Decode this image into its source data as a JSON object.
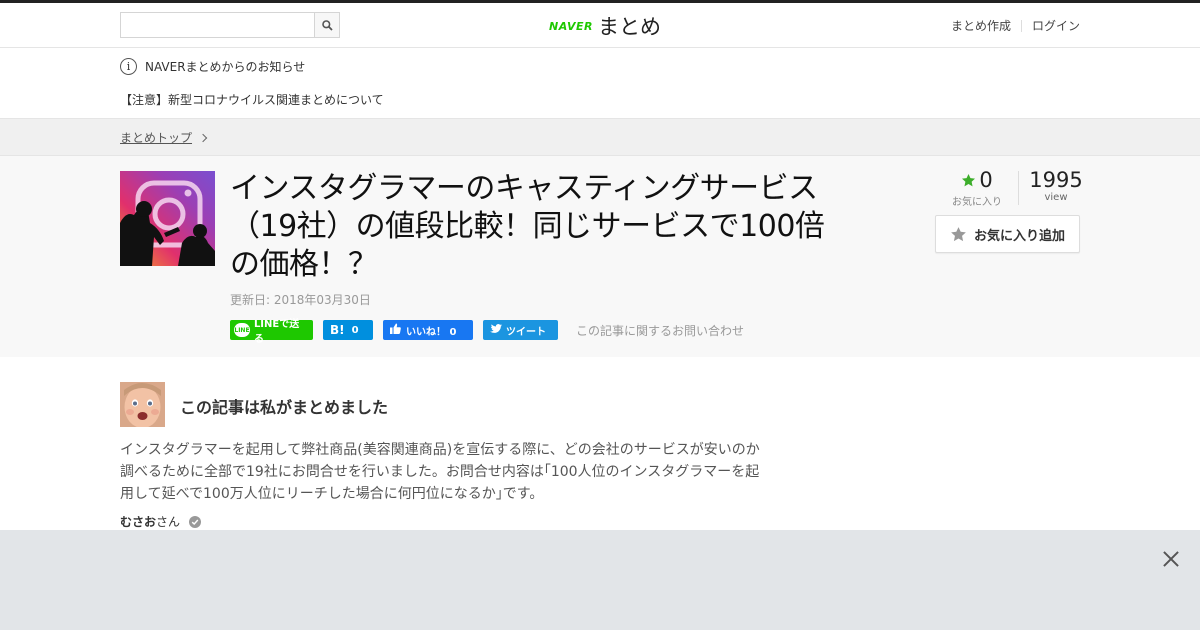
{
  "header": {
    "search": {
      "value": "",
      "placeholder": ""
    },
    "logo": {
      "brand": "NAVER",
      "name": "まとめ"
    },
    "links": {
      "create": "まとめ作成",
      "login": "ログイン"
    }
  },
  "notice": {
    "heading": "NAVERまとめからのお知らせ",
    "item": "【注意】新型コロナウイルス関連まとめについて"
  },
  "breadcrumb": {
    "home": "まとめトップ"
  },
  "article": {
    "title": "インスタグラマーのキャスティングサービス（19社）の値段比較！同じサービスで100倍の価格！？",
    "updated": "更新日: 2018年03月30日",
    "share": {
      "line": "LINEで送る",
      "line_badge": "LINE",
      "hatena_count": "0",
      "fb": "いいね！ 0",
      "tw": "ツイート",
      "contact": "この記事に関するお問い合わせ"
    },
    "stats": {
      "fav_count": "0",
      "fav_label": "お気に入り",
      "view_count": "1995",
      "view_label": "view"
    },
    "fav_button": "お気に入り追加"
  },
  "author": {
    "heading": "この記事は私がまとめました",
    "description": "インスタグラマーを起用して弊社商品(美容関連商品)を宣伝する際に、どの会社のサービスが安いのか調べるために全部で19社にお問合せを行いました。お問合せ内容は｢100人位のインスタグラマーを起用して延べで100万人位にリーチした場合に何円位になるか｣です。",
    "name": "むさおさん",
    "honorific": "さん"
  },
  "colors": {
    "accent": "#1ec800",
    "hatena": "#008fde",
    "facebook": "#1877f2",
    "twitter": "#1b95e0"
  }
}
